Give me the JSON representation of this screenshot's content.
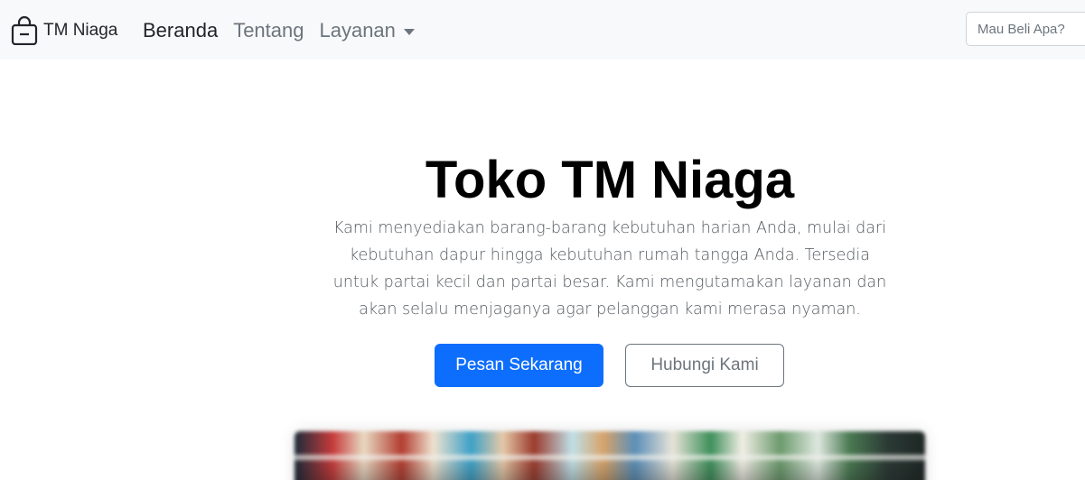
{
  "brand": {
    "icon": "shopping-bag-icon",
    "name": "TM Niaga"
  },
  "nav": {
    "items": [
      {
        "label": "Beranda",
        "active": true
      },
      {
        "label": "Tentang",
        "active": false
      },
      {
        "label": "Layanan",
        "active": false,
        "dropdown": true
      }
    ]
  },
  "search": {
    "placeholder": "Mau Beli Apa?",
    "value": ""
  },
  "hero": {
    "title": "Toko TM Niaga",
    "lead": "Kami menyediakan barang-barang kebutuhan harian Anda, mulai dari kebutuhan dapur hingga kebutuhan rumah tangga Anda. Tersedia untuk partai kecil dan partai besar. Kami mengutamakan layanan dan akan selalu menjaganya agar pelanggan kami merasa nyaman.",
    "primary_button": "Pesan Sekarang",
    "secondary_button": "Hubungi Kami"
  },
  "colors": {
    "navbar_bg": "#f8f9fa",
    "primary": "#0d6efd",
    "secondary": "#6c757d"
  }
}
